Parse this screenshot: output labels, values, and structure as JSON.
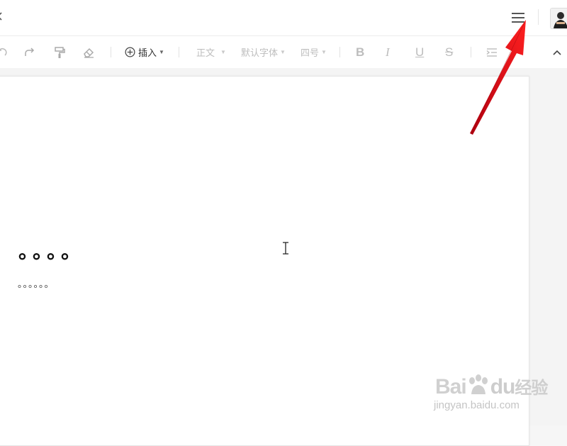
{
  "toolbar": {
    "insert_label": "插入",
    "style_label": "正文",
    "font_label": "默认字体",
    "size_label": "四号",
    "bold": "B",
    "italic": "I",
    "underline": "U",
    "strikethrough": "S"
  },
  "document": {
    "line1": "。。。。",
    "line2": "。。。。。。"
  },
  "watermark": {
    "logo_bai": "Bai",
    "logo_du": "du",
    "logo_jingyan": "经验",
    "url": "jingyan.baidu.com"
  },
  "icons": [
    "back-chevron-icon",
    "menu-icon",
    "avatar-icon",
    "undo-icon",
    "redo-icon",
    "format-painter-icon",
    "eraser-icon",
    "plus-circle-icon",
    "indent-icon",
    "collapse-chevron-icon",
    "text-cursor-icon"
  ],
  "colors": {
    "annotation_arrow": "#e8121a",
    "background": "#f6f6f6"
  }
}
